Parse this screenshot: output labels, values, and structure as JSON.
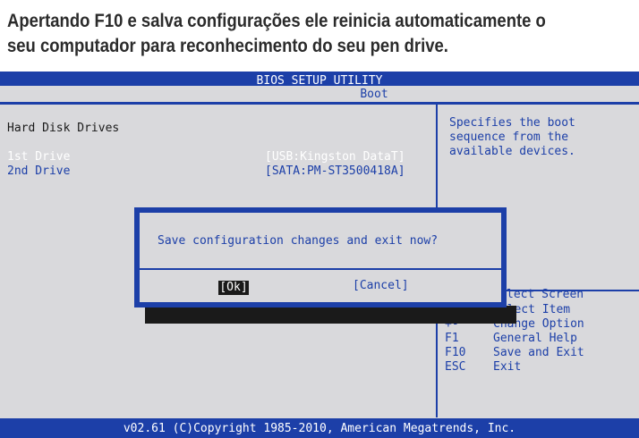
{
  "caption": {
    "line1": "Apertando F10 e salva configurações ele reinicia automaticamente o",
    "line2": "seu computador para reconhecimento do seu pen drive."
  },
  "bios": {
    "title": "BIOS SETUP UTILITY",
    "active_tab": "Boot",
    "section_title": "Hard Disk Drives",
    "drives": [
      {
        "label": "1st Drive",
        "value": "[USB:Kingston DataT]"
      },
      {
        "label": "2nd Drive",
        "value": "[SATA:PM-ST3500418A]"
      }
    ],
    "help_lines": [
      "Specifies the boot",
      "sequence from the",
      "available devices."
    ],
    "keys": [
      {
        "key": "",
        "desc": "lect Screen"
      },
      {
        "key": "↑↓",
        "desc": "Select Item"
      },
      {
        "key": "+-",
        "desc": "Change Option"
      },
      {
        "key": "F1",
        "desc": "General Help"
      },
      {
        "key": "F10",
        "desc": "Save and Exit"
      },
      {
        "key": "ESC",
        "desc": "Exit"
      }
    ],
    "dialog": {
      "message": "Save configuration changes and exit now?",
      "ok_label": "[Ok]",
      "cancel_label": "[Cancel]"
    },
    "footer": "v02.61 (C)Copyright 1985-2010, American Megatrends, Inc."
  },
  "colors": {
    "bios_blue": "#1c3fa8",
    "bios_gray": "#d9d9dc"
  }
}
